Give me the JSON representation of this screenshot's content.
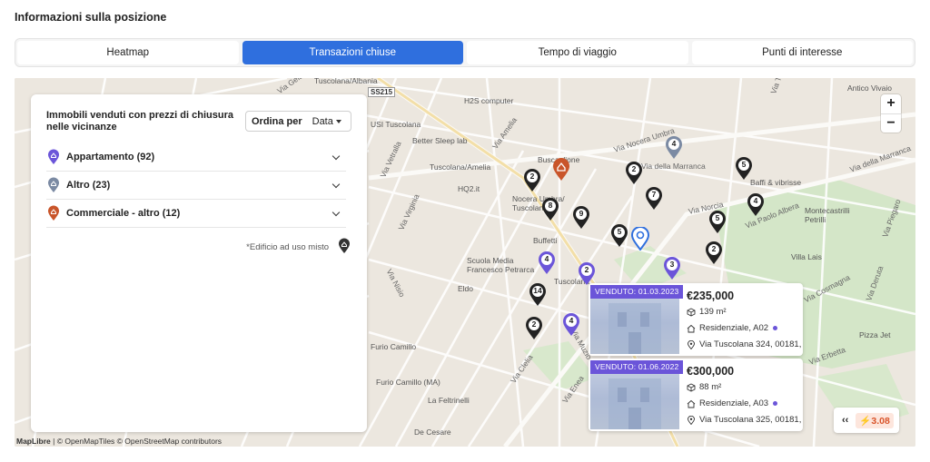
{
  "page_title": "Informazioni sulla posizione",
  "tabs": [
    {
      "label": "Heatmap",
      "active": false
    },
    {
      "label": "Transazioni chiuse",
      "active": true
    },
    {
      "label": "Tempo di viaggio",
      "active": false
    },
    {
      "label": "Punti di interesse",
      "active": false
    }
  ],
  "panel": {
    "heading": "Immobili venduti con prezzi di chiusura nelle vicinanze",
    "sort_label": "Ordina per",
    "sort_value": "Data",
    "categories": [
      {
        "label": "Appartamento (92)",
        "color": "#6b55d9"
      },
      {
        "label": "Altro (23)",
        "color": "#7b8aa3"
      },
      {
        "label": "Commerciale - altro (12)",
        "color": "#c9552a"
      }
    ],
    "mixed_note": "*Edificio ad uso misto"
  },
  "zoom": {
    "in": "+",
    "out": "−"
  },
  "cards": [
    {
      "badge": "VENDUTO: 01.03.2023",
      "price": "€235,000",
      "area": "139 m²",
      "type": "Residenziale, A02",
      "address": "Via Tuscolana 324, 00181, ..."
    },
    {
      "badge": "VENDUTO: 01.06.2022",
      "price": "€300,000",
      "area": "88 m²",
      "type": "Residenziale, A03",
      "address": "Via Tuscolana 325, 00181, ..."
    }
  ],
  "score": {
    "collapse": "‹‹",
    "value": "⚡3.08"
  },
  "attribution": {
    "brand": "MapLibre",
    "rest": " | © OpenMapTiles © OpenStreetMap contributors"
  },
  "map_labels": {
    "pois": [
      "Tuscolana/Albania",
      "USI Tuscolana",
      "Better Sleep lab",
      "H2S computer",
      "Tuscolana/Amelia",
      "HQ2.it",
      "Buscaglione",
      "Nocera Umbra/ Tuscolana",
      "Buffetti",
      "Scuola Media Francesco Petrarca",
      "Eldo",
      "Baffi & vibrisse",
      "Montecastrilli Petrilli",
      "Villa Lais",
      "Antico Vivaio",
      "Pizza Jet",
      "Furio Camillo",
      "Furio Camillo (MA)",
      "La Feltrinelli",
      "De Cesare",
      "Tuscolana"
    ],
    "streets": [
      "Via Nocera Umbra",
      "Via della Marranca",
      "Via Norcia",
      "Via Paolo Albera",
      "Via della Marranca",
      "Via Piegaro",
      "Via Amelia",
      "Via Vetralla",
      "Via Virginia",
      "Via Nisio",
      "Via Clelia",
      "Via Muzio Scevola",
      "Via Cosmagna",
      "Via Deruta",
      "Via Tevernia",
      "Via Gela",
      "Via Enea",
      "Via Erbetta"
    ],
    "road_shield": "SS215"
  },
  "map_pins": [
    {
      "label": "2",
      "kind": "dark"
    },
    {
      "label": "4",
      "kind": "grey"
    },
    {
      "label": "2",
      "kind": "dark"
    },
    {
      "label": "5",
      "kind": "dark"
    },
    {
      "label": "7",
      "kind": "dark"
    },
    {
      "label": "4",
      "kind": "dark"
    },
    {
      "label": "8",
      "kind": "dark"
    },
    {
      "label": "9",
      "kind": "dark"
    },
    {
      "label": "5",
      "kind": "dark"
    },
    {
      "label": "5",
      "kind": "dark"
    },
    {
      "label": "2",
      "kind": "dark"
    },
    {
      "label": "4",
      "kind": "purple"
    },
    {
      "label": "2",
      "kind": "purple"
    },
    {
      "label": "3",
      "kind": "purple"
    },
    {
      "label": "14",
      "kind": "dark"
    },
    {
      "label": "2",
      "kind": "dark"
    },
    {
      "label": "4",
      "kind": "purple"
    },
    {
      "label": "",
      "kind": "commercial"
    },
    {
      "label": "",
      "kind": "selected"
    }
  ]
}
